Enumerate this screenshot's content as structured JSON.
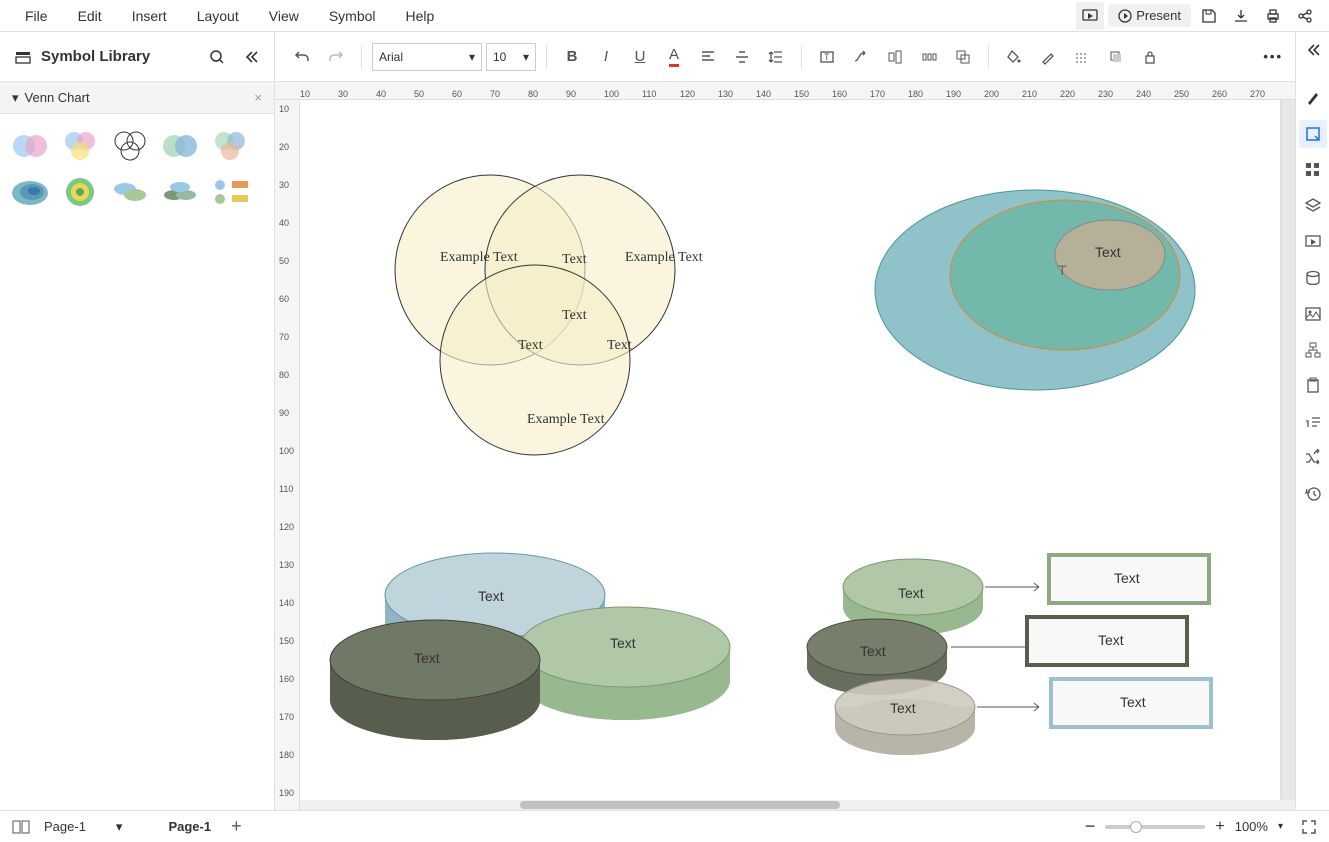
{
  "menubar": {
    "items": [
      "File",
      "Edit",
      "Insert",
      "Layout",
      "View",
      "Symbol",
      "Help"
    ]
  },
  "actions": {
    "present": "Present"
  },
  "library": {
    "title": "Symbol Library",
    "section": "Venn Chart"
  },
  "toolbar": {
    "font": "Arial",
    "size": "10"
  },
  "canvas": {
    "venn3": {
      "a": "Example Text",
      "b": "Example Text",
      "c": "Example Text",
      "ab": "Text",
      "ac": "Text",
      "bc": "Text",
      "abc": "Text"
    },
    "nested": {
      "inner": "Text",
      "hidden": "T"
    },
    "stack3d": {
      "top": "Text",
      "right": "Text",
      "left": "Text"
    },
    "linked": {
      "disks": [
        "Text",
        "Text",
        "Text"
      ],
      "boxes": [
        "Text",
        "Text",
        "Text"
      ]
    }
  },
  "pages": {
    "selector": "Page-1",
    "tab": "Page-1"
  },
  "status": {
    "zoom": "100%"
  },
  "ruler_h": [
    "10",
    "30",
    "40",
    "50",
    "60",
    "70",
    "80",
    "90",
    "100",
    "110",
    "120",
    "130",
    "140",
    "150",
    "160",
    "170",
    "180",
    "190",
    "200",
    "210",
    "220",
    "230",
    "240",
    "250",
    "260",
    "270"
  ],
  "ruler_v": [
    "10",
    "20",
    "30",
    "40",
    "50",
    "60",
    "70",
    "80",
    "90",
    "100",
    "110",
    "120",
    "130",
    "140",
    "150",
    "160",
    "170",
    "180",
    "190"
  ]
}
